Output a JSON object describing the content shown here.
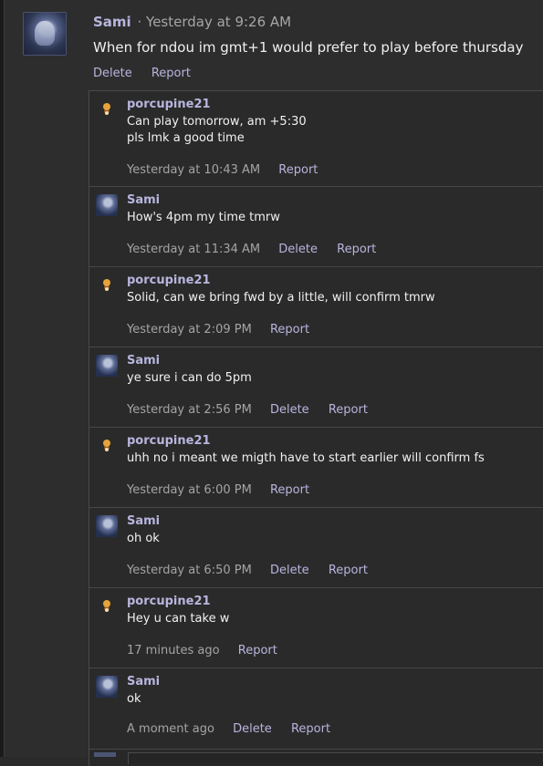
{
  "post": {
    "author": "Sami",
    "meta": "· Yesterday at 9:26 AM",
    "body": "When for ndou im gmt+1 would prefer to play before thursday",
    "actions": [
      "Delete",
      "Report"
    ]
  },
  "replies": [
    {
      "author": "porcupine21",
      "avatar": "porcupine",
      "lines": [
        "Can play tomorrow, am +5:30",
        "pls lmk a good time"
      ],
      "time": "Yesterday at 10:43 AM",
      "actions": [
        "Report"
      ]
    },
    {
      "author": "Sami",
      "avatar": "sami",
      "lines": [
        "How's 4pm my time tmrw"
      ],
      "time": "Yesterday at 11:34 AM",
      "actions": [
        "Delete",
        "Report"
      ]
    },
    {
      "author": "porcupine21",
      "avatar": "porcupine",
      "lines": [
        "Solid, can we bring fwd by a little, will confirm tmrw"
      ],
      "time": "Yesterday at 2:09 PM",
      "actions": [
        "Report"
      ]
    },
    {
      "author": "Sami",
      "avatar": "sami",
      "lines": [
        "ye sure i can do 5pm"
      ],
      "time": "Yesterday at 2:56 PM",
      "actions": [
        "Delete",
        "Report"
      ]
    },
    {
      "author": "porcupine21",
      "avatar": "porcupine",
      "lines": [
        "uhh no i meant we migth have to start earlier will confirm fs"
      ],
      "time": "Yesterday at 6:00 PM",
      "actions": [
        "Report"
      ]
    },
    {
      "author": "Sami",
      "avatar": "sami",
      "lines": [
        "oh ok"
      ],
      "time": "Yesterday at 6:50 PM",
      "actions": [
        "Delete",
        "Report"
      ]
    },
    {
      "author": "porcupine21",
      "avatar": "porcupine",
      "lines": [
        "Hey u can take w"
      ],
      "time": "17 minutes ago",
      "actions": [
        "Report"
      ]
    },
    {
      "author": "Sami",
      "avatar": "sami",
      "lines": [
        "ok"
      ],
      "time": "A moment ago",
      "actions": [
        "Delete",
        "Report"
      ]
    }
  ]
}
